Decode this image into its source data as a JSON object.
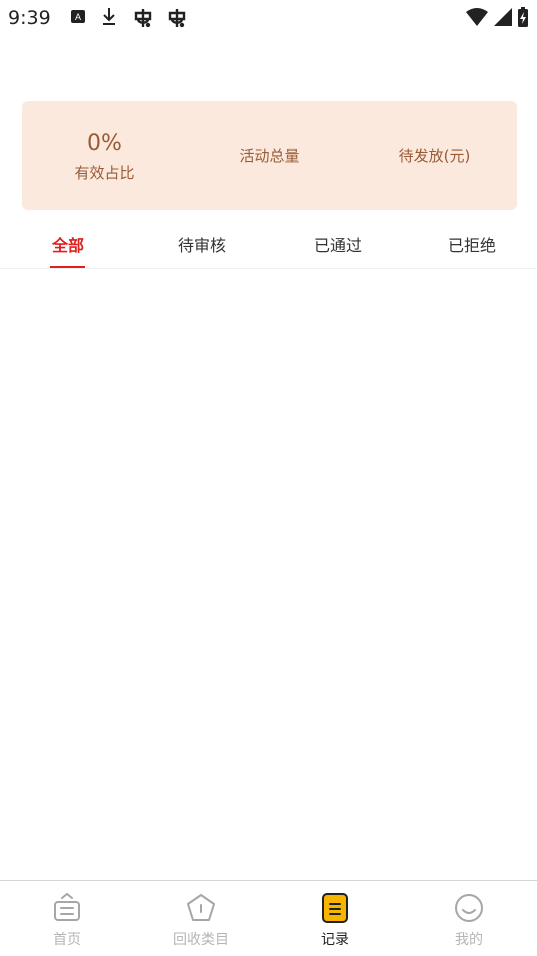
{
  "status_bar": {
    "time": "9:39",
    "icons_left": [
      "a-icon",
      "download-icon",
      "bug-icon",
      "bug-icon"
    ],
    "icons_right": [
      "wifi-icon",
      "signal-icon",
      "battery-charging-icon"
    ]
  },
  "stats": {
    "effective_ratio_value": "0%",
    "effective_ratio_label": "有效占比",
    "total_activity_label": "活动总量",
    "pending_payout_label": "待发放(元)"
  },
  "tabs": [
    {
      "label": "全部",
      "active": true
    },
    {
      "label": "待审核",
      "active": false
    },
    {
      "label": "已通过",
      "active": false
    },
    {
      "label": "已拒绝",
      "active": false
    }
  ],
  "bottom_nav": [
    {
      "label": "首页",
      "icon": "home-icon",
      "active": false
    },
    {
      "label": "回收类目",
      "icon": "category-icon",
      "active": false
    },
    {
      "label": "记录",
      "icon": "record-icon",
      "active": true
    },
    {
      "label": "我的",
      "icon": "profile-icon",
      "active": false
    }
  ],
  "colors": {
    "accent_red": "#e02020",
    "card_bg": "#fbe9dd",
    "card_text": "#9a5a36",
    "active_nav_icon": "#f7b500"
  }
}
